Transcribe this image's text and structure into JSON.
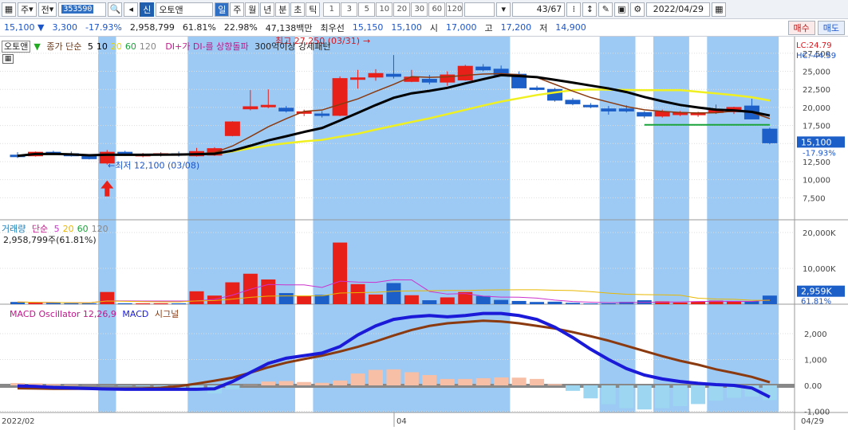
{
  "toolbar": {
    "type_label": "주",
    "scope_label": "전",
    "stock_code": "353590",
    "market_badge": "신",
    "stock_name": "오토앤",
    "periods": [
      "일",
      "주",
      "월",
      "년",
      "분",
      "초",
      "틱"
    ],
    "active_period": "일",
    "intervals": [
      "1",
      "3",
      "5",
      "10",
      "20",
      "30",
      "60",
      "120"
    ],
    "counter": "43/67",
    "date": "2022/04/29"
  },
  "quote": {
    "price": "15,100",
    "change": "3,300",
    "change_pct": "-17.93%",
    "volume": "2,958,799",
    "vol_ratio": "61.81%",
    "turnover": "22.98%",
    "amount": "47,138백만",
    "best_label": "최우선",
    "ask": "15,150",
    "bid": "15,100",
    "open_label": "시",
    "open": "17,000",
    "high_label": "고",
    "high": "17,200",
    "low_label": "저",
    "low": "14,900",
    "buy_label": "매수",
    "sell_label": "매도"
  },
  "price_panel": {
    "legend": {
      "name": "오토앤",
      "ma_label": "종가 단순",
      "ma_periods": [
        "5",
        "10",
        "20",
        "60",
        "120"
      ],
      "ma_colors": [
        "#000000",
        "#000000",
        "#e8d800",
        "#1aa33a",
        "#888888"
      ],
      "indicator": "DI+가 DI-를 상향돌파",
      "pattern": "300억이상 강세패턴"
    },
    "lc": "LC:24.79",
    "hc": "HC:-44.59",
    "high_marker": "최고 27,250 (03/31)",
    "low_marker": "최저 12,100 (03/08)",
    "last_price_tag": "15,100",
    "last_pct_tag": "-17.93%",
    "ticks": [
      "27,500",
      "25,000",
      "22,500",
      "20,000",
      "17,500",
      "15,000",
      "12,500",
      "10,000",
      "7,500"
    ]
  },
  "volume_panel": {
    "legend": {
      "name": "거래량",
      "ma_label": "단순",
      "ma_periods": [
        "5",
        "20",
        "60",
        "120"
      ],
      "ma_colors": [
        "#cc33cc",
        "#e8b800",
        "#1aa33a",
        "#888888"
      ],
      "value": "2,958,799주(61.81%)"
    },
    "ticks": [
      "20,000K",
      "10,000K"
    ],
    "last_tag": "2,959K",
    "last_pct": "61.81%"
  },
  "macd_panel": {
    "legend": {
      "name": "MACD Oscillator 12,26,9",
      "macd": "MACD",
      "signal": "시그널"
    },
    "ticks": [
      "2,000",
      "1,000",
      "0.00",
      "-1,000"
    ]
  },
  "x_axis": {
    "labels": [
      "2022/02",
      "04",
      "04/29"
    ]
  },
  "colors": {
    "up": "#e8201a",
    "down": "#1c5fc8",
    "highlight": "#9ccaf5"
  },
  "chart_data": {
    "type": "candlestick",
    "candles": [
      {
        "o": 13400,
        "h": 13800,
        "l": 13000,
        "c": 13300
      },
      {
        "o": 13300,
        "h": 13900,
        "l": 13200,
        "c": 13800
      },
      {
        "o": 13800,
        "h": 14000,
        "l": 13500,
        "c": 13600
      },
      {
        "o": 13600,
        "h": 13900,
        "l": 13200,
        "c": 13300
      },
      {
        "o": 13300,
        "h": 13500,
        "l": 12800,
        "c": 12900
      },
      {
        "o": 12300,
        "h": 14100,
        "l": 12100,
        "c": 13800
      },
      {
        "o": 13800,
        "h": 14000,
        "l": 13300,
        "c": 13400
      },
      {
        "o": 13400,
        "h": 13700,
        "l": 13100,
        "c": 13500
      },
      {
        "o": 13500,
        "h": 13800,
        "l": 13200,
        "c": 13600
      },
      {
        "o": 13600,
        "h": 13900,
        "l": 13200,
        "c": 13500
      },
      {
        "o": 13300,
        "h": 14400,
        "l": 13200,
        "c": 13900
      },
      {
        "o": 13400,
        "h": 14500,
        "l": 13300,
        "c": 14300
      },
      {
        "o": 16100,
        "h": 18100,
        "l": 16000,
        "c": 18000
      },
      {
        "o": 19800,
        "h": 22400,
        "l": 19600,
        "c": 20100
      },
      {
        "o": 20200,
        "h": 22500,
        "l": 19900,
        "c": 20300
      },
      {
        "o": 19900,
        "h": 20200,
        "l": 19300,
        "c": 19500
      },
      {
        "o": 19300,
        "h": 19700,
        "l": 18800,
        "c": 19400
      },
      {
        "o": 19100,
        "h": 19500,
        "l": 18600,
        "c": 18900
      },
      {
        "o": 18900,
        "h": 24300,
        "l": 18800,
        "c": 24000
      },
      {
        "o": 24000,
        "h": 25200,
        "l": 22600,
        "c": 24100
      },
      {
        "o": 24200,
        "h": 25300,
        "l": 23700,
        "c": 24700
      },
      {
        "o": 24600,
        "h": 27250,
        "l": 24000,
        "c": 24300
      },
      {
        "o": 23600,
        "h": 25200,
        "l": 23500,
        "c": 24200
      },
      {
        "o": 23900,
        "h": 24500,
        "l": 23200,
        "c": 23500
      },
      {
        "o": 23500,
        "h": 25000,
        "l": 23000,
        "c": 24500
      },
      {
        "o": 23800,
        "h": 25900,
        "l": 23700,
        "c": 25700
      },
      {
        "o": 25600,
        "h": 26000,
        "l": 25000,
        "c": 25200
      },
      {
        "o": 25300,
        "h": 25800,
        "l": 24900,
        "c": 24500
      },
      {
        "o": 24600,
        "h": 25000,
        "l": 23800,
        "c": 22700
      },
      {
        "o": 22700,
        "h": 23000,
        "l": 22300,
        "c": 22600
      },
      {
        "o": 22500,
        "h": 22700,
        "l": 20800,
        "c": 21000
      },
      {
        "o": 21000,
        "h": 21300,
        "l": 20300,
        "c": 20500
      },
      {
        "o": 20300,
        "h": 20600,
        "l": 19900,
        "c": 20100
      },
      {
        "o": 19800,
        "h": 20200,
        "l": 19000,
        "c": 19500
      },
      {
        "o": 19800,
        "h": 20300,
        "l": 19300,
        "c": 19500
      },
      {
        "o": 19300,
        "h": 19500,
        "l": 18500,
        "c": 18800
      },
      {
        "o": 18800,
        "h": 19700,
        "l": 18600,
        "c": 19400
      },
      {
        "o": 19000,
        "h": 19500,
        "l": 18800,
        "c": 19300
      },
      {
        "o": 19000,
        "h": 19400,
        "l": 18700,
        "c": 19200
      },
      {
        "o": 19300,
        "h": 20400,
        "l": 19100,
        "c": 19600
      },
      {
        "o": 19400,
        "h": 20100,
        "l": 19100,
        "c": 20000
      },
      {
        "o": 20200,
        "h": 21200,
        "l": 18400,
        "c": 18400
      },
      {
        "o": 17000,
        "h": 17200,
        "l": 14900,
        "c": 15100
      }
    ],
    "volumes_k": [
      620,
      420,
      360,
      280,
      260,
      3400,
      260,
      240,
      260,
      240,
      3600,
      2400,
      6100,
      8500,
      6900,
      3100,
      2300,
      2600,
      17200,
      5600,
      2700,
      5900,
      2500,
      1100,
      1900,
      3400,
      2300,
      1200,
      900,
      620,
      700,
      380,
      220,
      220,
      640,
      1100,
      790,
      460,
      740,
      980,
      900,
      860,
      2400
    ],
    "macd": [
      -20,
      -40,
      -80,
      -100,
      -120,
      -140,
      -150,
      -150,
      -150,
      -150,
      -150,
      -130,
      150,
      500,
      850,
      1050,
      1150,
      1250,
      1500,
      1950,
      2300,
      2550,
      2650,
      2700,
      2650,
      2700,
      2780,
      2780,
      2700,
      2550,
      2250,
      1850,
      1400,
      1000,
      650,
      400,
      250,
      150,
      80,
      30,
      0,
      -100,
      -450
    ],
    "signal": [
      -110,
      -120,
      -130,
      -130,
      -130,
      -130,
      -130,
      -120,
      -90,
      -30,
      70,
      180,
      300,
      490,
      700,
      880,
      1020,
      1150,
      1310,
      1490,
      1700,
      1930,
      2140,
      2300,
      2400,
      2450,
      2500,
      2470,
      2400,
      2300,
      2200,
      2060,
      1900,
      1730,
      1530,
      1330,
      1130,
      950,
      800,
      620,
      480,
      330,
      120
    ]
  }
}
